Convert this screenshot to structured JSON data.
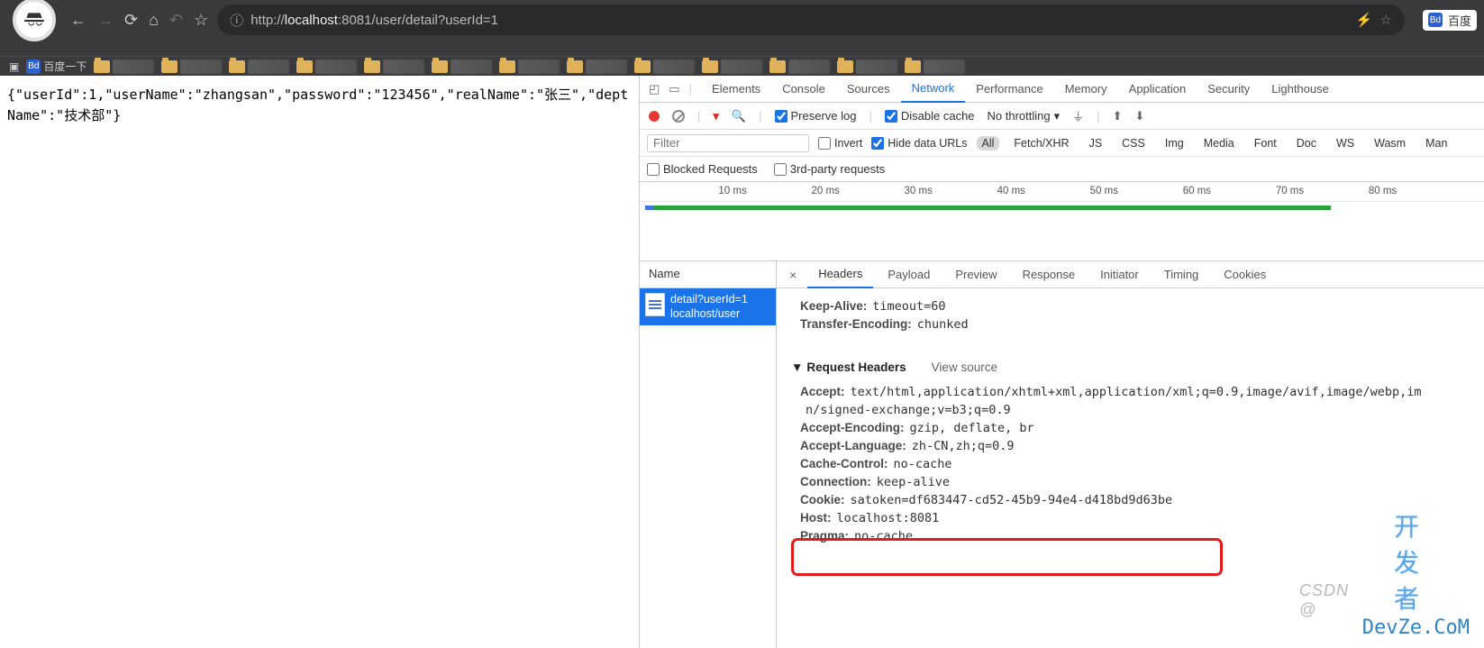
{
  "browser": {
    "url_prefix": "http://",
    "url_host": "localhost",
    "url_port": ":8081",
    "url_path": "/user/detail?userId=1",
    "search_engine": "百度"
  },
  "bookmarks": {
    "first": "百度一下"
  },
  "page_response": "{\"userId\":1,\"userName\":\"zhangsan\",\"password\":\"123456\",\"realName\":\"张三\",\"deptName\":\"技术部\"}",
  "devtools": {
    "tabs": {
      "elements": "Elements",
      "console": "Console",
      "sources": "Sources",
      "network": "Network",
      "performance": "Performance",
      "memory": "Memory",
      "application": "Application",
      "security": "Security",
      "lighthouse": "Lighthouse"
    },
    "toolbar": {
      "preserve_log": "Preserve log",
      "disable_cache": "Disable cache",
      "throttle": "No throttling"
    },
    "filter": {
      "placeholder": "Filter",
      "invert": "Invert",
      "hide_data": "Hide data URLs",
      "types": {
        "all": "All",
        "fetch": "Fetch/XHR",
        "js": "JS",
        "css": "CSS",
        "img": "Img",
        "media": "Media",
        "font": "Font",
        "doc": "Doc",
        "ws": "WS",
        "wasm": "Wasm",
        "manifest": "Man"
      },
      "blocked": "Blocked Requests",
      "thirdparty": "3rd-party requests"
    },
    "ruler": [
      "10 ms",
      "20 ms",
      "30 ms",
      "40 ms",
      "50 ms",
      "60 ms",
      "70 ms",
      "80 ms"
    ],
    "name_header": "Name",
    "request": {
      "line1": "detail?userId=1",
      "line2": "localhost/user"
    },
    "detail_tabs": {
      "headers": "Headers",
      "payload": "Payload",
      "preview": "Preview",
      "response": "Response",
      "initiator": "Initiator",
      "timing": "Timing",
      "cookies": "Cookies"
    },
    "resp": {
      "keep_alive_k": "Keep-Alive:",
      "keep_alive_v": "timeout=60",
      "te_k": "Transfer-Encoding:",
      "te_v": "chunked"
    },
    "req_section": "Request Headers",
    "view_source": "View source",
    "req": {
      "accept_k": "Accept:",
      "accept_v": "text/html,application/xhtml+xml,application/xml;q=0.9,image/avif,image/webp,im",
      "accept_v2": "n/signed-exchange;v=b3;q=0.9",
      "ae_k": "Accept-Encoding:",
      "ae_v": "gzip, deflate, br",
      "al_k": "Accept-Language:",
      "al_v": "zh-CN,zh;q=0.9",
      "cc_k": "Cache-Control:",
      "cc_v": "no-cache",
      "conn_k": "Connection:",
      "conn_v": "keep-alive",
      "cookie_k": "Cookie:",
      "cookie_v": "satoken=df683447-cd52-45b9-94e4-d418bd9d63be",
      "host_k": "Host:",
      "host_v": "localhost:8081",
      "pragma_k": "Pragma:",
      "pragma_v": "no-cache"
    }
  },
  "watermark": {
    "csdn": "CSDN @",
    "cn": "开发者",
    "dev": "DevZe.CoM"
  }
}
